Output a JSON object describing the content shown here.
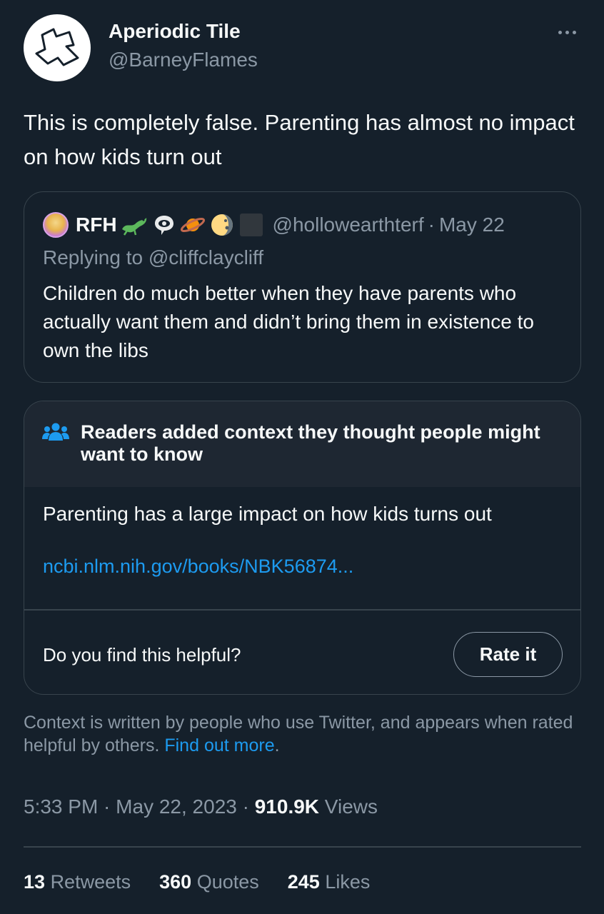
{
  "author": {
    "display_name": "Aperiodic Tile",
    "handle": "@BarneyFlames",
    "avatar_icon": "aperiodic-tile-logo"
  },
  "tweet": {
    "text": "This is completely false. Parenting has almost no impact on how kids turn out"
  },
  "quoted_tweet": {
    "name": "RFH",
    "name_emojis": [
      "lizard-emoji",
      "eye-speech-bubble-emoji",
      "ringed-planet-emoji",
      "moon-emoji",
      "black-square-emoji"
    ],
    "handle": "@hollowearthterf",
    "separator": "·",
    "date": "May 22",
    "replying_to": "Replying to @cliffclaycliff",
    "text": "Children do much better when they have parents who actually want them and didn’t bring them in existence to own the libs"
  },
  "community_note": {
    "title": "Readers added context they thought people might want to know",
    "title_icon": "people-icon",
    "text": "Parenting has a large impact on how kids turns out",
    "link_text": "ncbi.nlm.nih.gov/books/NBK56874...",
    "helpful_question": "Do you find this helpful?",
    "rate_button": "Rate it",
    "info_text": "Context is written by people who use Twitter, and appears when rated helpful by others.",
    "info_link": "Find out more",
    "info_end": "."
  },
  "meta": {
    "time": "5:33 PM",
    "sep1": " · ",
    "date": "May 22, 2023",
    "sep2": " · ",
    "views_count": "910.9K",
    "views_label": " Views"
  },
  "stats": {
    "retweets": "13",
    "retweets_label": "Retweets",
    "quotes": "360",
    "quotes_label": "Quotes",
    "likes": "245",
    "likes_label": "Likes"
  },
  "colors": {
    "background": "#15202b",
    "primary_text": "#f7f9f9",
    "secondary_text": "#8b98a5",
    "accent": "#1d9bf0",
    "border": "#38444d"
  }
}
